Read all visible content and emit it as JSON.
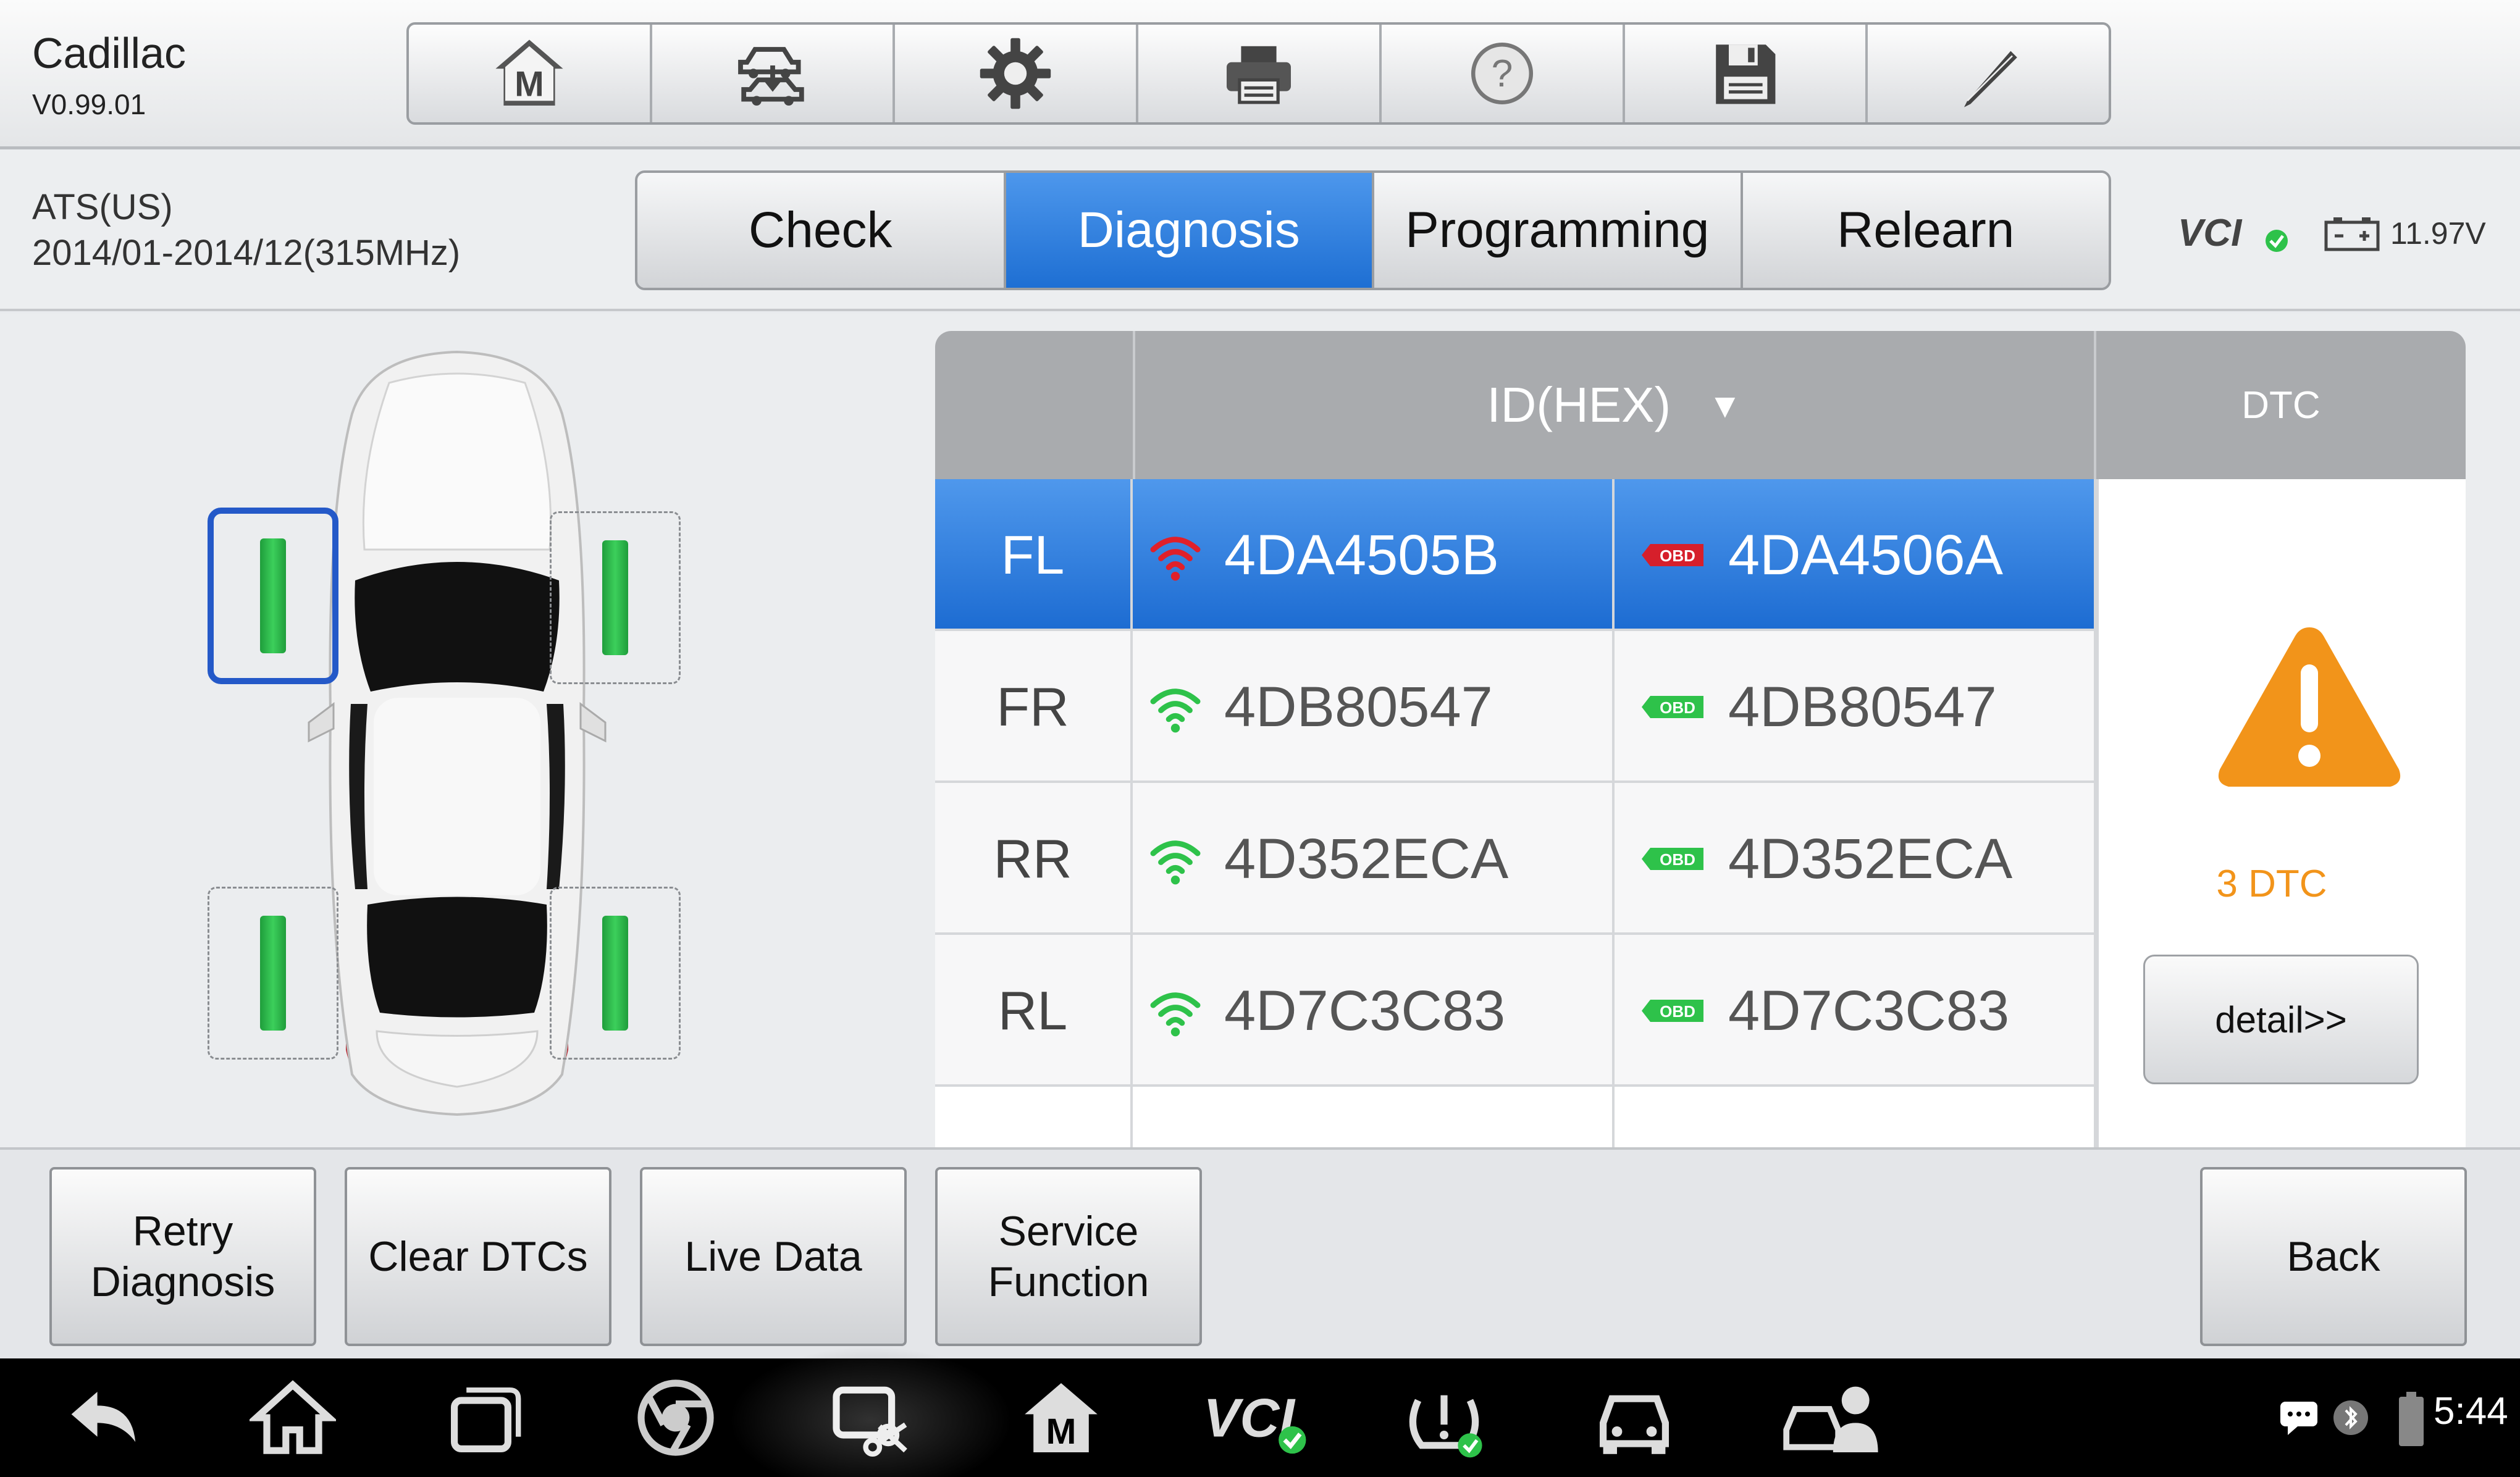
{
  "header": {
    "vehicle": "Cadillac",
    "version": "V0.99.01",
    "toolbar": [
      {
        "icon": "home-m-icon"
      },
      {
        "icon": "vehicle-swap-icon"
      },
      {
        "icon": "settings-gear-icon"
      },
      {
        "icon": "printer-icon"
      },
      {
        "icon": "help-icon"
      },
      {
        "icon": "save-icon"
      },
      {
        "icon": "edit-pencil-icon"
      }
    ]
  },
  "subheader": {
    "system": "ATS(US)",
    "range": "2014/01-2014/12(315MHz)",
    "tabs": [
      "Check",
      "Diagnosis",
      "Programming",
      "Relearn"
    ],
    "active_tab": "Diagnosis",
    "vci_label": "VCI",
    "battery_voltage": "11.97V"
  },
  "table": {
    "id_header": "ID(HEX)",
    "dtc_header": "DTC",
    "rows": [
      {
        "position": "FL",
        "tool_id": "4DA4505B",
        "obd_id": "4DA4506A",
        "tool_signal": "red",
        "obd_status": "red",
        "selected": true
      },
      {
        "position": "FR",
        "tool_id": "4DB80547",
        "obd_id": "4DB80547",
        "tool_signal": "green",
        "obd_status": "green",
        "selected": false
      },
      {
        "position": "RR",
        "tool_id": "4D352ECA",
        "obd_id": "4D352ECA",
        "tool_signal": "green",
        "obd_status": "green",
        "selected": false
      },
      {
        "position": "RL",
        "tool_id": "4D7C3C83",
        "obd_id": "4D7C3C83",
        "tool_signal": "green",
        "obd_status": "green",
        "selected": false
      }
    ],
    "obd_badge": "OBD",
    "dtc_count": "3 DTC",
    "detail_label": "detail>>"
  },
  "wheels": {
    "selected": "FL",
    "positions": [
      "FL",
      "FR",
      "RL",
      "RR"
    ]
  },
  "actions": {
    "retry": "Retry Diagnosis",
    "clear": "Clear DTCs",
    "live": "Live Data",
    "service": "Service Function",
    "back": "Back"
  },
  "navbar": {
    "icons": [
      "back-icon",
      "home-icon",
      "recent-apps-icon",
      "chrome-icon",
      "screen-record-icon",
      "maxi-m-icon",
      "vci-icon",
      "tpms-icon",
      "car-icon",
      "remote-expert-icon"
    ],
    "time": "5:44"
  },
  "colors": {
    "accent_blue": "#1e6fd3",
    "ok_green": "#2ec24a",
    "error_red": "#e0202a",
    "warning_orange": "#f2941a"
  }
}
